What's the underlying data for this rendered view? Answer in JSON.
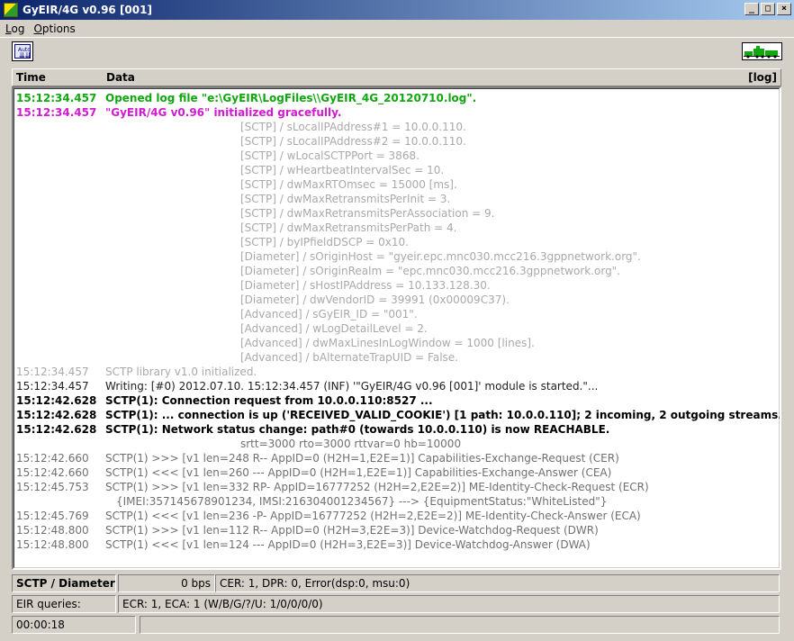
{
  "window": {
    "title": "GyEIR/4G  v0.96  [001]"
  },
  "menu": {
    "items": [
      "Log",
      "Options"
    ]
  },
  "toolbar": {
    "auto_label": "Auto"
  },
  "log_header": {
    "time": "Time",
    "data": "Data",
    "log": "[log]"
  },
  "log_rows": [
    {
      "time": "15:12:34.457",
      "text": "Opened log file \"e:\\GyEIR\\LogFiles\\\\GyEIR_4G_20120710.log\".",
      "style": "c-green"
    },
    {
      "time": "15:12:34.457",
      "text": "\"GyEIR/4G  v0.96\" initialized gracefully.",
      "style": "c-magenta"
    },
    {
      "time": "",
      "text": "[SCTP] / sLocalIPAddress#1 = 10.0.0.110.",
      "style": "c-gray",
      "indent": true
    },
    {
      "time": "",
      "text": "[SCTP] / sLocalIPAddress#2 = 10.0.0.110.",
      "style": "c-gray",
      "indent": true
    },
    {
      "time": "",
      "text": "[SCTP] / wLocalSCTPPort = 3868.",
      "style": "c-gray",
      "indent": true
    },
    {
      "time": "",
      "text": "[SCTP] / wHeartbeatIntervalSec = 10.",
      "style": "c-gray",
      "indent": true
    },
    {
      "time": "",
      "text": "[SCTP] / dwMaxRTOmsec = 15000 [ms].",
      "style": "c-gray",
      "indent": true
    },
    {
      "time": "",
      "text": "[SCTP] / dwMaxRetransmitsPerInit = 3.",
      "style": "c-gray",
      "indent": true
    },
    {
      "time": "",
      "text": "[SCTP] / dwMaxRetransmitsPerAssociation = 9.",
      "style": "c-gray",
      "indent": true
    },
    {
      "time": "",
      "text": "[SCTP] / dwMaxRetransmitsPerPath = 4.",
      "style": "c-gray",
      "indent": true
    },
    {
      "time": "",
      "text": "[SCTP] / byIPfieldDSCP = 0x10.",
      "style": "c-gray",
      "indent": true
    },
    {
      "time": "",
      "text": "[Diameter] / sOriginHost = \"gyeir.epc.mnc030.mcc216.3gppnetwork.org\".",
      "style": "c-gray",
      "indent": true
    },
    {
      "time": "",
      "text": "[Diameter] / sOriginRealm = \"epc.mnc030.mcc216.3gppnetwork.org\".",
      "style": "c-gray",
      "indent": true
    },
    {
      "time": "",
      "text": "[Diameter] / sHostIPAddress = 10.133.128.30.",
      "style": "c-gray",
      "indent": true
    },
    {
      "time": "",
      "text": "[Diameter] / dwVendorID = 39991 (0x00009C37).",
      "style": "c-gray",
      "indent": true
    },
    {
      "time": "",
      "text": "[Advanced] / sGyEIR_ID = \"001\".",
      "style": "c-gray",
      "indent": true
    },
    {
      "time": "",
      "text": "[Advanced] / wLogDetailLevel = 2.",
      "style": "c-gray",
      "indent": true
    },
    {
      "time": "",
      "text": "[Advanced] / dwMaxLinesInLogWindow = 1000 [lines].",
      "style": "c-gray",
      "indent": true
    },
    {
      "time": "",
      "text": "[Advanced] / bAlternateTrapUID = False.",
      "style": "c-gray",
      "indent": true
    },
    {
      "time": "15:12:34.457",
      "text": "SCTP library v1.0 initialized.",
      "style": "c-gray"
    },
    {
      "time": "15:12:34.457",
      "text": "Writing: [#0) 2012.07.10. 15:12:34.457 (INF) '\"GyEIR/4G  v0.96  [001]' module is started.\"...",
      "style": "c-dark"
    },
    {
      "time": "15:12:42.628",
      "text": "SCTP(1): Connection request from 10.0.0.110:8527 ...",
      "style": "c-black"
    },
    {
      "time": "15:12:42.628",
      "text": "SCTP(1): ... connection is up ('RECEIVED_VALID_COOKIE') [1 path: 10.0.0.110]; 2 incoming, 2 outgoing streams.",
      "style": "c-black"
    },
    {
      "time": "15:12:42.628",
      "text": "SCTP(1): Network status change: path#0 (towards 10.0.0.110) is now REACHABLE.",
      "style": "c-black"
    },
    {
      "time": "",
      "text": "srtt=3000  rto=3000  rttvar=0  hb=10000",
      "style": "c-dgray",
      "indent": "mid"
    },
    {
      "time": "15:12:42.660",
      "text": "SCTP(1) >>> [v1 len=248 R-- AppID=0 (H2H=1,E2E=1)] Capabilities-Exchange-Request (CER)",
      "style": "c-dgray"
    },
    {
      "time": "15:12:42.660",
      "text": "SCTP(1) <<< [v1 len=260 --- AppID=0 (H2H=1,E2E=1)] Capabilities-Exchange-Answer (CEA)",
      "style": "c-dgray"
    },
    {
      "time": "15:12:45.753",
      "text": "SCTP(1) >>> [v1 len=332 RP- AppID=16777252 (H2H=2,E2E=2)] ME-Identity-Check-Request (ECR)",
      "style": "c-dgray"
    },
    {
      "time": "",
      "text": "{IMEI:357145678901234, IMSI:216304001234567} ---> {EquipmentStatus:\"WhiteListed\"}",
      "style": "c-dgray",
      "indent": "cont"
    },
    {
      "time": "15:12:45.769",
      "text": "SCTP(1) <<< [v1 len=236 -P- AppID=16777252 (H2H=2,E2E=2)] ME-Identity-Check-Answer (ECA)",
      "style": "c-dgray"
    },
    {
      "time": "15:12:48.800",
      "text": "SCTP(1) >>> [v1 len=112 R-- AppID=0 (H2H=3,E2E=3)] Device-Watchdog-Request (DWR)",
      "style": "c-dgray"
    },
    {
      "time": "15:12:48.800",
      "text": "SCTP(1) <<< [v1 len=124 --- AppID=0 (H2H=3,E2E=3)] Device-Watchdog-Answer (DWA)",
      "style": "c-dgray"
    }
  ],
  "status": {
    "sctp_label": "SCTP / Diameter:",
    "bps": "0 bps",
    "cer": "CER: 1,  DPR: 0,  Error(dsp:0, msu:0)",
    "eir_label": "EIR queries:",
    "ecr": "ECR: 1,  ECA: 1  (W/B/G/?/U: 1/0/0/0/0)",
    "elapsed": "00:00:18",
    "extra": ""
  }
}
